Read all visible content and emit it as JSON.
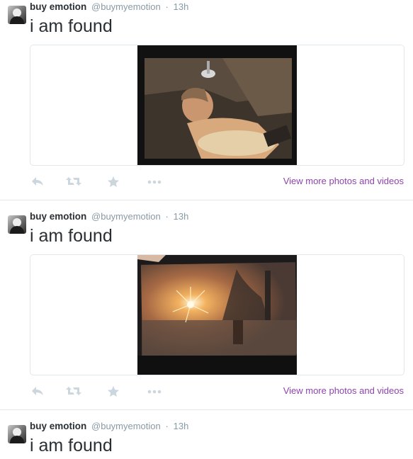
{
  "tweets": [
    {
      "name": "buy emotion",
      "handle": "@buymyemotion",
      "separator": "·",
      "time": "13h",
      "text": "i am found",
      "has_media": true,
      "more_link": "View more photos and videos"
    },
    {
      "name": "buy emotion",
      "handle": "@buymyemotion",
      "separator": "·",
      "time": "13h",
      "text": "i am found",
      "has_media": true,
      "more_link": "View more photos and videos"
    },
    {
      "name": "buy emotion",
      "handle": "@buymyemotion",
      "separator": "·",
      "time": "13h",
      "text": "i am found",
      "has_media": false
    }
  ],
  "action_icons": [
    "reply-icon",
    "retweet-icon",
    "favorite-icon",
    "more-icon"
  ],
  "colors": {
    "text": "#292f33",
    "meta": "#8899a6",
    "link": "#8e44ad",
    "action_icon": "#ccd6dd",
    "border": "#e1e8ed"
  }
}
